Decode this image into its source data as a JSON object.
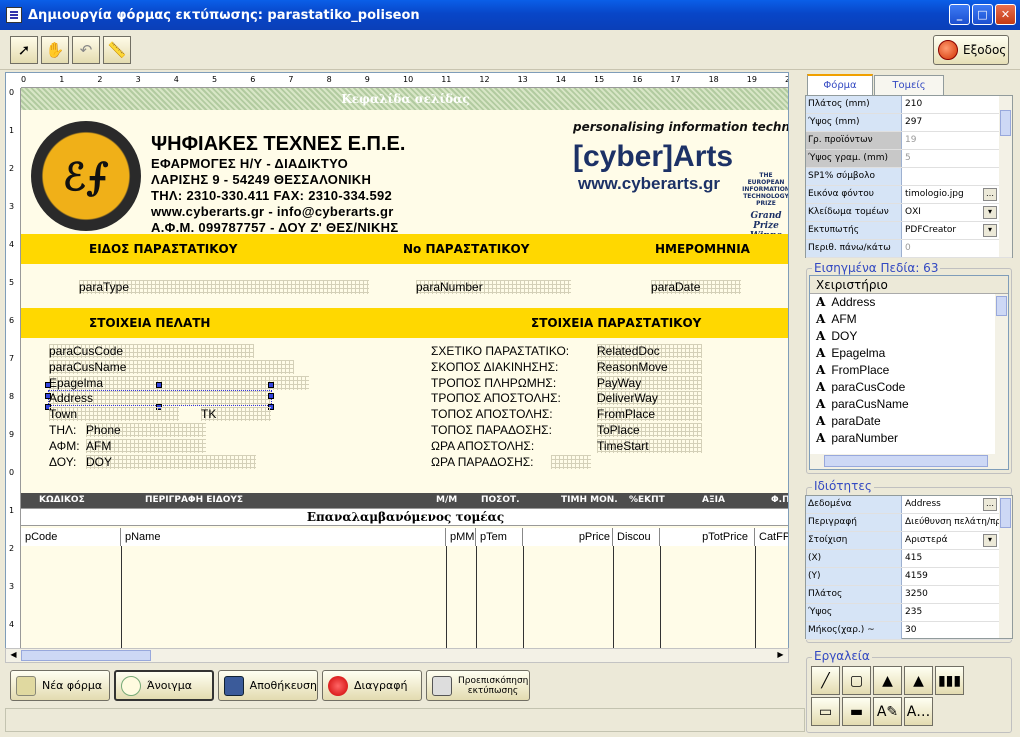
{
  "window": {
    "title": "Δημιουργία φόρμας εκτύπωσης: parastatiko_poliseon",
    "min": "_",
    "max": "□",
    "close": "✕"
  },
  "toolbar": {
    "exit_label": "Εξοδος"
  },
  "ruler": {
    "h": [
      "0",
      "1",
      "2",
      "3",
      "4",
      "5",
      "6",
      "7",
      "8",
      "9",
      "10",
      "11",
      "12",
      "13",
      "14",
      "15",
      "16",
      "17",
      "18",
      "19",
      "20"
    ],
    "v": [
      "0",
      "1",
      "2",
      "3",
      "4",
      "5",
      "6",
      "7",
      "8",
      "9",
      "0",
      "1",
      "2",
      "3",
      "4"
    ]
  },
  "report": {
    "header_band": "Κεφαλίδα σελίδας",
    "logo_text": "ℰ⨍",
    "company_name": "ΨΗΦΙΑΚΕΣ ΤΕΧΝΕΣ Ε.Π.Ε.",
    "company_lines": [
      "ΕΦΑΡΜΟΓΕΣ    Η/Υ    -    ΔΙΑΔΙΚΤΥΟ",
      "ΛΑΡΙΣΗΣ  9  -  54249  ΘΕΣΣΑΛΟΝΙΚΗ",
      "ΤΗΛ: 2310-330.411 FAX: 2310-334.592",
      "www.cyberarts.gr  -  info@cyberarts.gr",
      "Α.Φ.Μ. 099787757 - ΔΟΥ Ζ' ΘΕΣ/ΝΙΚΗΣ"
    ],
    "tagline": "personalising information technolo",
    "brand": "[cyber]Arts",
    "brand_url": "www.cyberarts.gr",
    "prize_text": "THE EUROPEAN INFORMATION TECHNOLOGY PRIZE",
    "prize_grand": "Grand Prize Winne",
    "band1": {
      "type": "ΕΙΔΟΣ ΠΑΡΑΣΤΑΤΙΚΟΥ",
      "number": "Νο ΠΑΡΑΣΤΑΤΙΚΟΥ",
      "date": "ΗΜΕΡΟΜΗΝΙΑ"
    },
    "fields1": {
      "type": "paraType",
      "number": "paraNumber",
      "date": "paraDate"
    },
    "band2": {
      "customer": "ΣΤΟΙΧΕΙΑ ΠΕΛΑΤΗ",
      "doc": "ΣΤΟΙΧΕΙΑ ΠΑΡΑΣΤΑΤΙΚΟΥ"
    },
    "customer_fields": {
      "code": "paraCusCode",
      "name": "paraCusName",
      "epag": "Epagelma",
      "address": "Address",
      "town": "Town",
      "tk": "TK",
      "phone_label": "ΤΗΛ:",
      "phone": "Phone",
      "afm_label": "ΑΦΜ:",
      "afm": "AFM",
      "doy_label": "ΔΟΥ:",
      "doy": "DOY"
    },
    "doc_fields": [
      {
        "label": "ΣΧΕΤΙΚΟ ΠΑΡΑΣΤΑΤΙΚΟ:",
        "value": "RelatedDoc"
      },
      {
        "label": "ΣΚΟΠΟΣ ΔΙΑΚΙΝΗΣΗΣ:",
        "value": "ReasonMove"
      },
      {
        "label": "ΤΡΟΠΟΣ ΠΛΗΡΩΜΗΣ:",
        "value": "PayWay"
      },
      {
        "label": "ΤΡΟΠΟΣ ΑΠΟΣΤΟΛΗΣ:",
        "value": "DeliverWay"
      },
      {
        "label": "ΤΟΠΟΣ ΑΠΟΣΤΟΛΗΣ:",
        "value": "FromPlace"
      },
      {
        "label": "ΤΟΠΟΣ ΠΑΡΑΔΟΣΗΣ:",
        "value": "ToPlace"
      },
      {
        "label": "ΩΡΑ ΑΠΟΣΤΟΛΗΣ:",
        "value": "TimeStart"
      },
      {
        "label": "ΩΡΑ ΠΑΡΑΔΟΣΗΣ:",
        "value": ""
      }
    ],
    "columns": [
      "ΚΩΔΙΚΟΣ",
      "ΠΕΡΙΓΡΑΦΗ ΕΙΔΟΥΣ",
      "Μ/Μ",
      "ΠΟΣΟΤ.",
      "ΤΙΜΗ ΜΟΝ.",
      "%ΕΚΠΤ",
      "ΑΞΙΑ",
      "Φ.Π"
    ],
    "repeat_band": "Επαναλαμβανόμενος τομέας",
    "detail_fields": [
      "pCode",
      "pName",
      "pMM",
      "pTem",
      "pPrice",
      "Discou",
      "pTotPrice",
      "CatFP"
    ]
  },
  "bottom": {
    "new": "Νέα φόρμα",
    "open": "Άνοιγμα",
    "save": "Αποθήκευση",
    "delete": "Διαγραφή",
    "preview": "Προεπισκόπηση εκτύπωσης"
  },
  "panel": {
    "tabs": [
      "Φόρμα",
      "Τομείς"
    ],
    "form_props": [
      {
        "name": "Πλάτος (mm)",
        "value": "210"
      },
      {
        "name": "Ύψος (mm)",
        "value": "297"
      },
      {
        "name": "Γρ. προϊόντων",
        "value": "19",
        "disabled": true
      },
      {
        "name": "Ύψος γραμ. (mm)",
        "value": "5",
        "disabled": true
      },
      {
        "name": "SP1% σύμβολο",
        "value": ""
      },
      {
        "name": "Εικόνα φόντου",
        "value": "timologio.jpg"
      },
      {
        "name": "Κλείδωμα τομέων",
        "value": "ΟΧΙ"
      },
      {
        "name": "Εκτυπωτής",
        "value": "PDFCreator"
      },
      {
        "name": "Περιθ. πάνω/κάτω",
        "value": "0"
      }
    ],
    "fields_title": "Εισηγμένα Πεδία: 63",
    "fields_head": "Χειριστήριο",
    "fields": [
      "Address",
      "AFM",
      "DOY",
      "Epagelma",
      "FromPlace",
      "paraCusCode",
      "paraCusName",
      "paraDate",
      "paraNumber"
    ],
    "props_title": "Ιδιότητες",
    "props": [
      {
        "name": "Δεδομένα",
        "value": "Address"
      },
      {
        "name": "Περιγραφή",
        "value": "Διεύθυνση πελάτη/πρ"
      },
      {
        "name": "Στοίχιση",
        "value": "Αριστερά"
      },
      {
        "name": "(X)",
        "value": "415"
      },
      {
        "name": "(Y)",
        "value": "4159"
      },
      {
        "name": "Πλάτος",
        "value": "3250"
      },
      {
        "name": "Ύψος",
        "value": "235"
      },
      {
        "name": "Μήκος(χαρ.) ~",
        "value": "30"
      }
    ],
    "tools_title": "Εργαλεία"
  }
}
